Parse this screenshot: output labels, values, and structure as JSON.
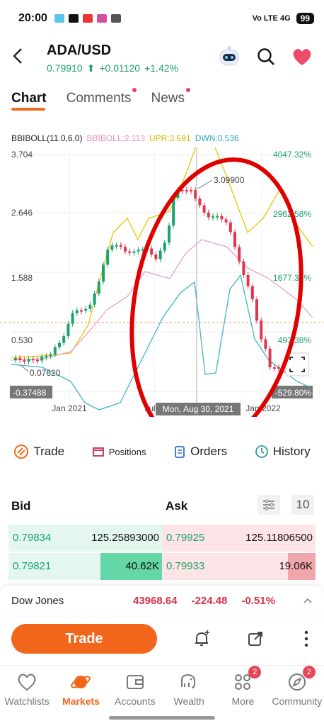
{
  "status": {
    "time": "20:00",
    "signal": "Vo LTE 4G",
    "battery": "99"
  },
  "header": {
    "pair": "ADA/USD",
    "price": "0.79910",
    "change": "+0.01120",
    "pct": "+1.42%"
  },
  "tabs": [
    {
      "label": "Chart"
    },
    {
      "label": "Comments"
    },
    {
      "label": "News"
    }
  ],
  "indicator": {
    "name": "BBIBOLL(11.0,6.0)",
    "bbiboll": "BBIBOLL:2.113",
    "upr": "UPR:3.691",
    "dwn": "DWN:0.536"
  },
  "chart_data": {
    "type": "line",
    "y_ticks_left": [
      "3.704",
      "2.646",
      "1.588",
      "0.530",
      "-0.37488"
    ],
    "y_ticks_right": [
      "4047.32%",
      "2962.58%",
      "1677.33%",
      "493.38%",
      "-529.80%"
    ],
    "x_ticks": [
      "Jan 2021",
      "Jul",
      "Jan 2022"
    ],
    "crosshair_label": "Mon, Aug 30, 2021",
    "annotations": {
      "high": "3.09900",
      "low": "0.07620"
    },
    "colors": {
      "up": "#1aa36b",
      "down": "#e0374e",
      "upper_band": "#e8c400",
      "mid_band": "#e8a0c8",
      "lower_band": "#3fb3c8",
      "annotation_ring": "#e00000"
    }
  },
  "actions": {
    "trade": "Trade",
    "positions": "Positions",
    "orders": "Orders",
    "history": "History"
  },
  "book": {
    "bid_label": "Bid",
    "ask_label": "Ask",
    "depth": "10",
    "rows": [
      {
        "bid": "0.79834",
        "bid_qty": "125.25893000",
        "ask": "0.79925",
        "ask_qty": "125.11806500",
        "bid_fill": 0.0,
        "ask_fill": 0.0
      },
      {
        "bid": "0.79821",
        "bid_qty": "40.62K",
        "ask": "0.79933",
        "ask_qty": "19.06K",
        "bid_fill": 0.4,
        "ask_fill": 0.18
      }
    ]
  },
  "ticker": {
    "name": "Dow Jones",
    "value": "43968.64",
    "change": "-224.48",
    "pct": "-0.51%"
  },
  "tradebar": {
    "trade": "Trade"
  },
  "nav": [
    {
      "label": "Watchlists",
      "icon": "heart-outline-icon"
    },
    {
      "label": "Markets",
      "icon": "planet-icon"
    },
    {
      "label": "Accounts",
      "icon": "wallet-icon"
    },
    {
      "label": "Wealth",
      "icon": "elephant-icon"
    },
    {
      "label": "More",
      "icon": "grid-icon",
      "badge": "2"
    },
    {
      "label": "Community",
      "icon": "compass-icon",
      "badge": "2"
    }
  ]
}
